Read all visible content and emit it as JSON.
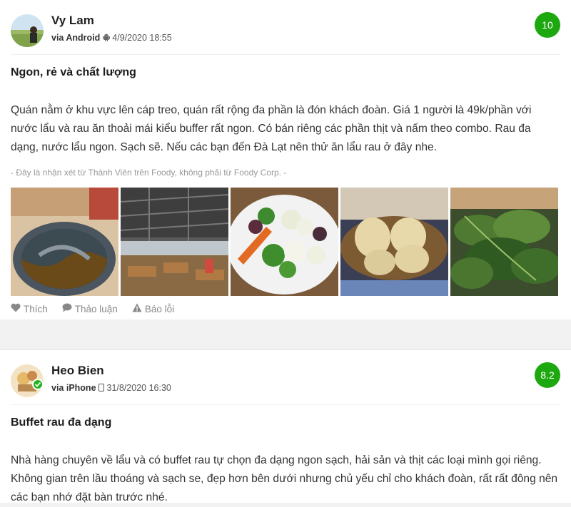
{
  "reviews": [
    {
      "username": "Vy Lam",
      "via": "via Android",
      "platform_icon": "android-icon",
      "datetime": "4/9/2020 18:55",
      "score": "10",
      "title": "Ngon, rẻ và chất lượng",
      "body": "Quán nằm ở khu vực lên cáp treo, quán rất rộng đa phần là đón khách đoàn. Giá 1 người là 49k/phần với nước lẩu và rau ăn thoải mái kiểu buffer rất ngon. Có bán riêng các phần thịt và nấm theo combo. Rau đa dạng, nước lẩu ngon. Sạch sẽ. Nếu các bạn đến Đà Lạt nên thử ăn lẩu rau ở đây nhe.",
      "disclaimer": "- Đây là nhận xét từ Thành Viên trên Foody, không phải từ Foody Corp. -",
      "actions": {
        "like": "Thích",
        "discuss": "Thảo luận",
        "report": "Báo lỗi"
      }
    },
    {
      "username": "Heo Bien",
      "via": "via iPhone",
      "platform_icon": "apple-icon",
      "datetime": "31/8/2020 16:30",
      "score": "8.2",
      "title": "Buffet rau đa dạng",
      "body": "Nhà hàng chuyên về lẩu và có buffet rau tự chọn đa dạng ngon sạch, hải sản và thịt các loại mình gọi riêng. Không gian trên lầu thoáng và sạch se, đẹp hơn bên dưới nhưng chủ yếu chỉ cho khách đoàn, rất rất đông nên các bạn nhớ đặt bàn trước nhé."
    }
  ],
  "colors": {
    "score_badge": "#1ca80e",
    "verified": "#20b31c",
    "muted": "#888888"
  }
}
